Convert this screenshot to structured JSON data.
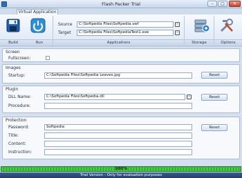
{
  "window": {
    "title": "Flash Packer Trial",
    "minimize": "–",
    "maximize": "□",
    "close": "✕"
  },
  "ribbon": {
    "tab": "Virtual Application",
    "build_label": "Build",
    "run_label": "Run",
    "applications_label": "Applications",
    "storage_label": "Storage",
    "options_label": "Options",
    "source_label": "Source",
    "source_value": "C:\\Softpedia Files\\Softpedia.swf",
    "target_label": "Target",
    "target_value": "C:\\Softpedia Files\\SoftpediaTest1.exe"
  },
  "screen": {
    "title": "Screen",
    "fullscreen_label": "Fullscreen:"
  },
  "images": {
    "title": "Images",
    "startup_label": "Startup:",
    "startup_value": "C:\\Softpedia Files\\Softpedia Leaves.jpg",
    "reset_label": "Reset"
  },
  "plugin": {
    "title": "Plugin",
    "dll_label": "DLL Name:",
    "dll_value": "C:\\Softpedia Files\\Softpedia.dll",
    "procedure_label": "Procedure:",
    "procedure_value": "",
    "reset_label": "Reset"
  },
  "protection": {
    "title": "Protection",
    "password_label": "Password:",
    "password_value": "Softpedia",
    "title_label": "Title:",
    "title_value": "",
    "content_label": "Content:",
    "content_value": "",
    "instruction_label": "Instruction:",
    "instruction_value": "",
    "reset_label": "Reset"
  },
  "progress": {
    "text": "100%",
    "value": 1.0
  },
  "status": {
    "text": "Trial Version - Only for evaluation purposes"
  },
  "colors": {
    "accent": "#2f6db8",
    "progress": "#2fae2f",
    "status_bar": "#213f6d"
  }
}
